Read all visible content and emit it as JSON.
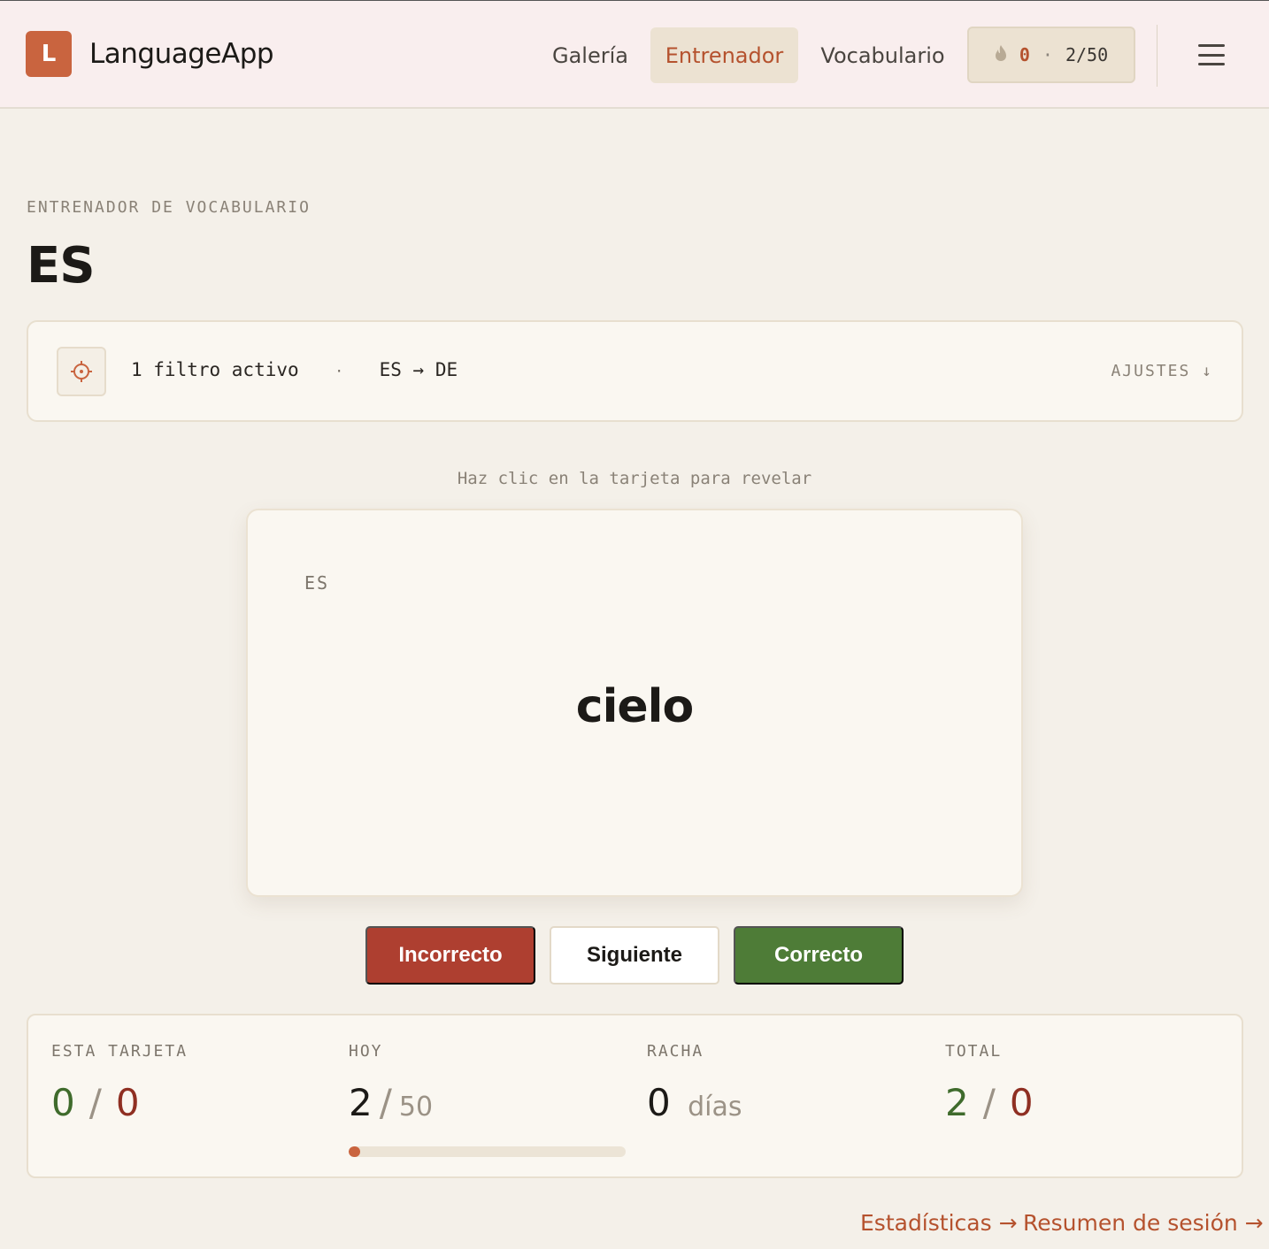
{
  "header": {
    "logo_letter": "L",
    "app_name": "LanguageApp",
    "nav": [
      {
        "label": "Galería",
        "active": false
      },
      {
        "label": "Entrenador",
        "active": true
      },
      {
        "label": "Vocabulario",
        "active": false
      }
    ],
    "counter": {
      "icon": "flame-icon",
      "streak": "0",
      "separator": "·",
      "progress": "2/50"
    },
    "menu_icon": "hamburger-menu-icon"
  },
  "page": {
    "eyebrow": "ENTRENADOR DE VOCABULARIO",
    "title": "ES"
  },
  "filter_bar": {
    "icon": "target-icon",
    "active_filters": "1 filtro activo",
    "separator": "·",
    "direction": "ES → DE",
    "settings_label": "AJUSTES ↓"
  },
  "hint": "Haz clic en la tarjeta para revelar",
  "card": {
    "language": "ES",
    "word": "cielo"
  },
  "actions": {
    "wrong_label": "Incorrecto",
    "next_label": "Siguiente",
    "right_label": "Correcto"
  },
  "stats": {
    "this_card": {
      "label": "ESTA TARJETA",
      "correct": "0",
      "slash": "/",
      "wrong": "0"
    },
    "today": {
      "label": "HOY",
      "done": "2",
      "slash": "/",
      "goal": "50",
      "progress_fraction": 0.04
    },
    "streak": {
      "label": "RACHA",
      "value": "0",
      "unit": "días"
    },
    "total": {
      "label": "TOTAL",
      "correct": "2",
      "slash": "/",
      "wrong": "0"
    }
  },
  "footer": {
    "stats_link": "Estadísticas →",
    "summary_link": "Resumen de sesión →"
  },
  "colors": {
    "accent": "#c9643f",
    "correct": "#4e7c37",
    "incorrect": "#ae3f30",
    "background": "#f4f0e9"
  }
}
